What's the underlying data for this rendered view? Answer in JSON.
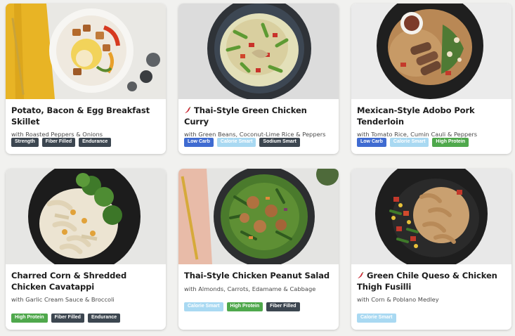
{
  "colors": {
    "background": "#f1f1ef",
    "tag_dark": "#3c4650",
    "tag_blue": "#3f6bd1",
    "tag_light": "#a9d9f2",
    "tag_green": "#4fa84c",
    "spicy_icon": "#c8242f"
  },
  "meals": [
    {
      "title": "Potato, Bacon & Egg Breakfast Skillet",
      "subtitle": "with Roasted Peppers & Onions",
      "spicy": false,
      "tags": [
        "Strength",
        "Fiber Filled",
        "Endurance"
      ]
    },
    {
      "title": "Thai-Style Green Chicken Curry",
      "subtitle": "with Green Beans, Coconut-Lime Rice & Peppers",
      "spicy": true,
      "tags": [
        "Low Carb",
        "Calorie Smart",
        "Sodium Smart"
      ]
    },
    {
      "title": "Mexican-Style Adobo Pork Tenderloin",
      "subtitle": "with Tomato Rice, Cumin Cauli & Peppers",
      "spicy": false,
      "tags": [
        "Low Carb",
        "Calorie Smart",
        "High Protein"
      ]
    },
    {
      "title": "Charred Corn & Shredded Chicken Cavatappi",
      "subtitle": "with Garlic Cream Sauce & Broccoli",
      "spicy": false,
      "tags": [
        "High Protein",
        "Fiber Filled",
        "Endurance"
      ]
    },
    {
      "title": "Thai-Style Chicken Peanut Salad",
      "subtitle": "with Almonds, Carrots, Edamame & Cabbage",
      "spicy": false,
      "tags": [
        "Calorie Smart",
        "High Protein",
        "Fiber Filled"
      ]
    },
    {
      "title": "Green Chile Queso & Chicken Thigh Fusilli",
      "subtitle": "with Corn & Poblano Medley",
      "spicy": true,
      "tags": [
        "Calorie Smart"
      ]
    }
  ]
}
